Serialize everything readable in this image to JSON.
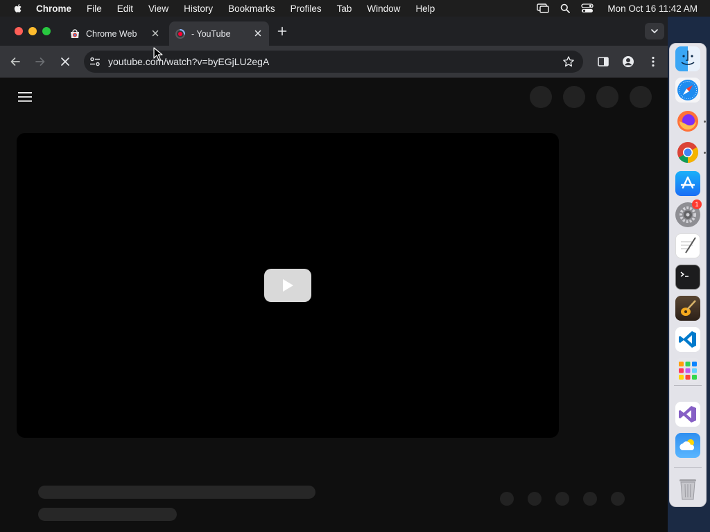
{
  "menubar": {
    "app_name": "Chrome",
    "menus": [
      "File",
      "Edit",
      "View",
      "History",
      "Bookmarks",
      "Profiles",
      "Tab",
      "Window",
      "Help"
    ],
    "clock": "Mon Oct 16  11:42 AM"
  },
  "tabs": [
    {
      "title": "Chrome Web Store",
      "active": false
    },
    {
      "title": "- YouTube",
      "active": true
    }
  ],
  "toolbar": {
    "url": "youtube.com/watch?v=byEGjLU2egA"
  },
  "dock": {
    "apps": [
      "Finder",
      "Safari",
      "Firefox",
      "Chrome",
      "App Store",
      "System Settings",
      "TextEdit",
      "Terminal",
      "GarageBand",
      "Visual Studio Code",
      "Launchpad",
      "Visual Studio",
      "Weather",
      "Trash"
    ],
    "settings_badge": "1"
  },
  "colors": {
    "youtube_red": "#ff0033",
    "page_bg": "#0f0f0f",
    "toolbar_bg": "#35363a"
  }
}
